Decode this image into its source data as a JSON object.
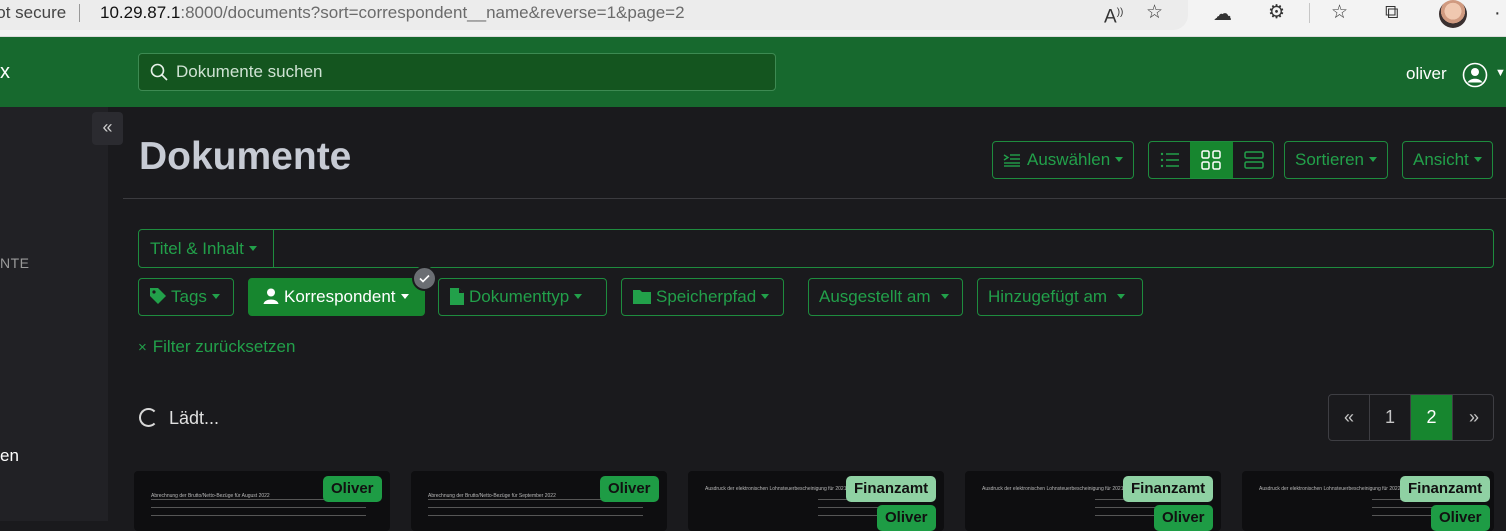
{
  "browser": {
    "security_label": "Not secure",
    "url_host": "10.29.87.1",
    "url_rest": ":8000/documents?sort=correspondent__name&reverse=1&page=2"
  },
  "navbar": {
    "brand_fragment": "x",
    "search_placeholder": "Dokumente suchen",
    "user_name": "oliver"
  },
  "sidebar": {
    "heading_fragment": "NTE",
    "item_fragment": "en"
  },
  "main": {
    "title": "Dokumente",
    "toolbar": {
      "select_label": "Auswählen",
      "sort_label": "Sortieren",
      "view_label": "Ansicht",
      "display_modes": [
        "list",
        "grid",
        "large-cards"
      ],
      "active_display_mode": "grid"
    },
    "filters": {
      "text_filter_label": "Titel & Inhalt",
      "text_filter_value": "",
      "buttons": [
        {
          "label": "Tags",
          "active": false
        },
        {
          "label": "Korrespondent",
          "active": true
        },
        {
          "label": "Dokumenttyp",
          "active": false
        },
        {
          "label": "Speicherpfad",
          "active": false
        },
        {
          "label": "Ausgestellt am",
          "active": false
        },
        {
          "label": "Hinzugefügt am",
          "active": false
        }
      ],
      "reset_label": "Filter zurücksetzen"
    },
    "status": {
      "loading_text": "Lädt..."
    },
    "pagination": {
      "prev": "«",
      "pages": [
        "1",
        "2"
      ],
      "current_page": "2",
      "next": "»"
    },
    "cards": [
      {
        "badges": [
          "Oliver"
        ],
        "thumb_title": "Abrechnung der Brutto/Netto-Bezüge für August 2022"
      },
      {
        "badges": [
          "Oliver"
        ],
        "thumb_title": "Abrechnung der Brutto/Netto-Bezüge für September 2022"
      },
      {
        "badges": [
          "Finanzamt",
          "Oliver"
        ],
        "thumb_title": "Ausdruck der elektronischen Lohnsteuerbescheinigung für 2021"
      },
      {
        "badges": [
          "Finanzamt",
          "Oliver"
        ],
        "thumb_title": "Ausdruck der elektronischen Lohnsteuerbescheinigung für 2021"
      },
      {
        "badges": [
          "Finanzamt",
          "Oliver"
        ],
        "thumb_title": "Ausdruck der elektronischen Lohnsteuerbescheinigung für 2022"
      }
    ]
  },
  "colors": {
    "brand_green": "#17692e",
    "accent_green": "#22a04a",
    "badge_correspondent": "#1e9c45",
    "badge_correspondent_alt": "#8fd1a3",
    "background": "#1a1a1d"
  }
}
